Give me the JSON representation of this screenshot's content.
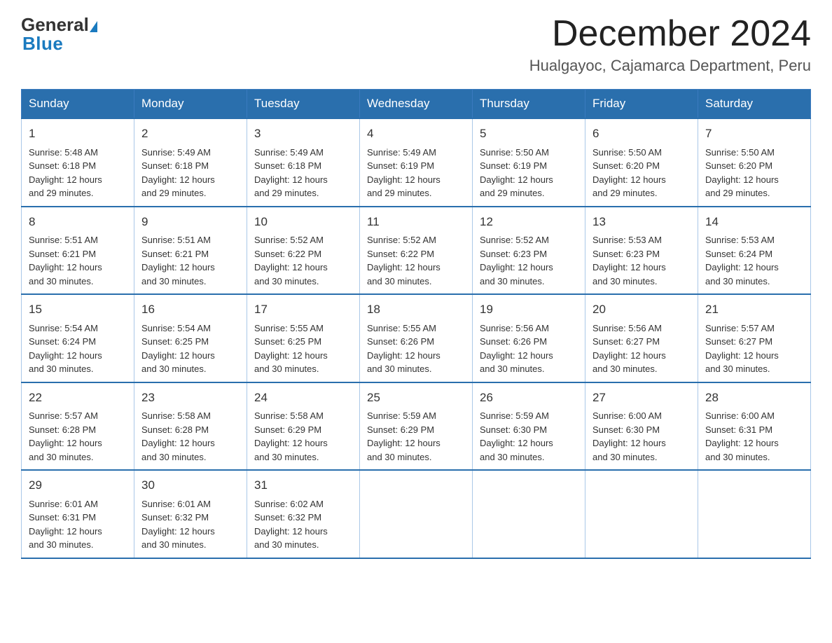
{
  "logo": {
    "general": "General",
    "blue": "Blue"
  },
  "title": {
    "month": "December 2024",
    "location": "Hualgayoc, Cajamarca Department, Peru"
  },
  "headers": [
    "Sunday",
    "Monday",
    "Tuesday",
    "Wednesday",
    "Thursday",
    "Friday",
    "Saturday"
  ],
  "weeks": [
    [
      {
        "day": "1",
        "sunrise": "5:48 AM",
        "sunset": "6:18 PM",
        "daylight": "12 hours and 29 minutes."
      },
      {
        "day": "2",
        "sunrise": "5:49 AM",
        "sunset": "6:18 PM",
        "daylight": "12 hours and 29 minutes."
      },
      {
        "day": "3",
        "sunrise": "5:49 AM",
        "sunset": "6:18 PM",
        "daylight": "12 hours and 29 minutes."
      },
      {
        "day": "4",
        "sunrise": "5:49 AM",
        "sunset": "6:19 PM",
        "daylight": "12 hours and 29 minutes."
      },
      {
        "day": "5",
        "sunrise": "5:50 AM",
        "sunset": "6:19 PM",
        "daylight": "12 hours and 29 minutes."
      },
      {
        "day": "6",
        "sunrise": "5:50 AM",
        "sunset": "6:20 PM",
        "daylight": "12 hours and 29 minutes."
      },
      {
        "day": "7",
        "sunrise": "5:50 AM",
        "sunset": "6:20 PM",
        "daylight": "12 hours and 29 minutes."
      }
    ],
    [
      {
        "day": "8",
        "sunrise": "5:51 AM",
        "sunset": "6:21 PM",
        "daylight": "12 hours and 30 minutes."
      },
      {
        "day": "9",
        "sunrise": "5:51 AM",
        "sunset": "6:21 PM",
        "daylight": "12 hours and 30 minutes."
      },
      {
        "day": "10",
        "sunrise": "5:52 AM",
        "sunset": "6:22 PM",
        "daylight": "12 hours and 30 minutes."
      },
      {
        "day": "11",
        "sunrise": "5:52 AM",
        "sunset": "6:22 PM",
        "daylight": "12 hours and 30 minutes."
      },
      {
        "day": "12",
        "sunrise": "5:52 AM",
        "sunset": "6:23 PM",
        "daylight": "12 hours and 30 minutes."
      },
      {
        "day": "13",
        "sunrise": "5:53 AM",
        "sunset": "6:23 PM",
        "daylight": "12 hours and 30 minutes."
      },
      {
        "day": "14",
        "sunrise": "5:53 AM",
        "sunset": "6:24 PM",
        "daylight": "12 hours and 30 minutes."
      }
    ],
    [
      {
        "day": "15",
        "sunrise": "5:54 AM",
        "sunset": "6:24 PM",
        "daylight": "12 hours and 30 minutes."
      },
      {
        "day": "16",
        "sunrise": "5:54 AM",
        "sunset": "6:25 PM",
        "daylight": "12 hours and 30 minutes."
      },
      {
        "day": "17",
        "sunrise": "5:55 AM",
        "sunset": "6:25 PM",
        "daylight": "12 hours and 30 minutes."
      },
      {
        "day": "18",
        "sunrise": "5:55 AM",
        "sunset": "6:26 PM",
        "daylight": "12 hours and 30 minutes."
      },
      {
        "day": "19",
        "sunrise": "5:56 AM",
        "sunset": "6:26 PM",
        "daylight": "12 hours and 30 minutes."
      },
      {
        "day": "20",
        "sunrise": "5:56 AM",
        "sunset": "6:27 PM",
        "daylight": "12 hours and 30 minutes."
      },
      {
        "day": "21",
        "sunrise": "5:57 AM",
        "sunset": "6:27 PM",
        "daylight": "12 hours and 30 minutes."
      }
    ],
    [
      {
        "day": "22",
        "sunrise": "5:57 AM",
        "sunset": "6:28 PM",
        "daylight": "12 hours and 30 minutes."
      },
      {
        "day": "23",
        "sunrise": "5:58 AM",
        "sunset": "6:28 PM",
        "daylight": "12 hours and 30 minutes."
      },
      {
        "day": "24",
        "sunrise": "5:58 AM",
        "sunset": "6:29 PM",
        "daylight": "12 hours and 30 minutes."
      },
      {
        "day": "25",
        "sunrise": "5:59 AM",
        "sunset": "6:29 PM",
        "daylight": "12 hours and 30 minutes."
      },
      {
        "day": "26",
        "sunrise": "5:59 AM",
        "sunset": "6:30 PM",
        "daylight": "12 hours and 30 minutes."
      },
      {
        "day": "27",
        "sunrise": "6:00 AM",
        "sunset": "6:30 PM",
        "daylight": "12 hours and 30 minutes."
      },
      {
        "day": "28",
        "sunrise": "6:00 AM",
        "sunset": "6:31 PM",
        "daylight": "12 hours and 30 minutes."
      }
    ],
    [
      {
        "day": "29",
        "sunrise": "6:01 AM",
        "sunset": "6:31 PM",
        "daylight": "12 hours and 30 minutes."
      },
      {
        "day": "30",
        "sunrise": "6:01 AM",
        "sunset": "6:32 PM",
        "daylight": "12 hours and 30 minutes."
      },
      {
        "day": "31",
        "sunrise": "6:02 AM",
        "sunset": "6:32 PM",
        "daylight": "12 hours and 30 minutes."
      },
      null,
      null,
      null,
      null
    ]
  ],
  "labels": {
    "sunrise": "Sunrise: ",
    "sunset": "Sunset: ",
    "daylight": "Daylight: "
  }
}
